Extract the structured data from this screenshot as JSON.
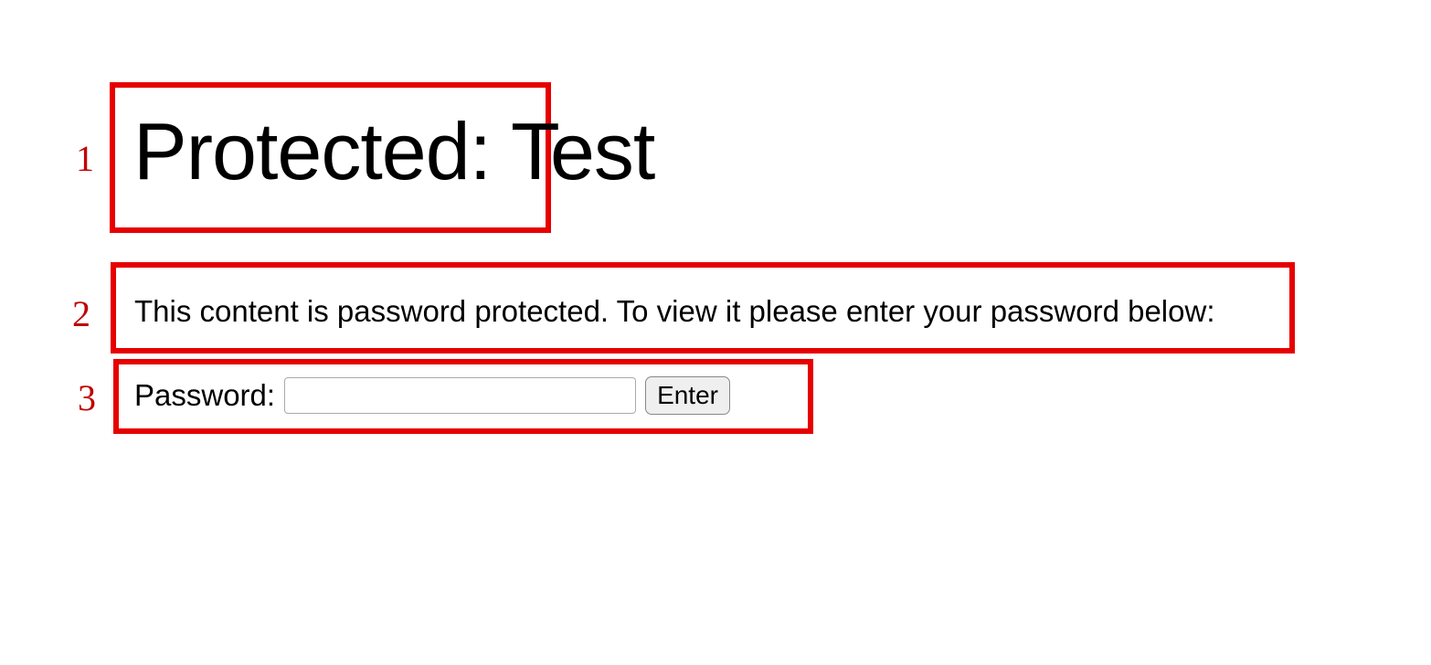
{
  "markers": {
    "one": "1",
    "two": "2",
    "three": "3"
  },
  "title": "Protected: Test",
  "description": "This content is password protected. To view it please enter your password below:",
  "form": {
    "password_label": "Password:",
    "password_value": "",
    "submit_label": "Enter"
  }
}
